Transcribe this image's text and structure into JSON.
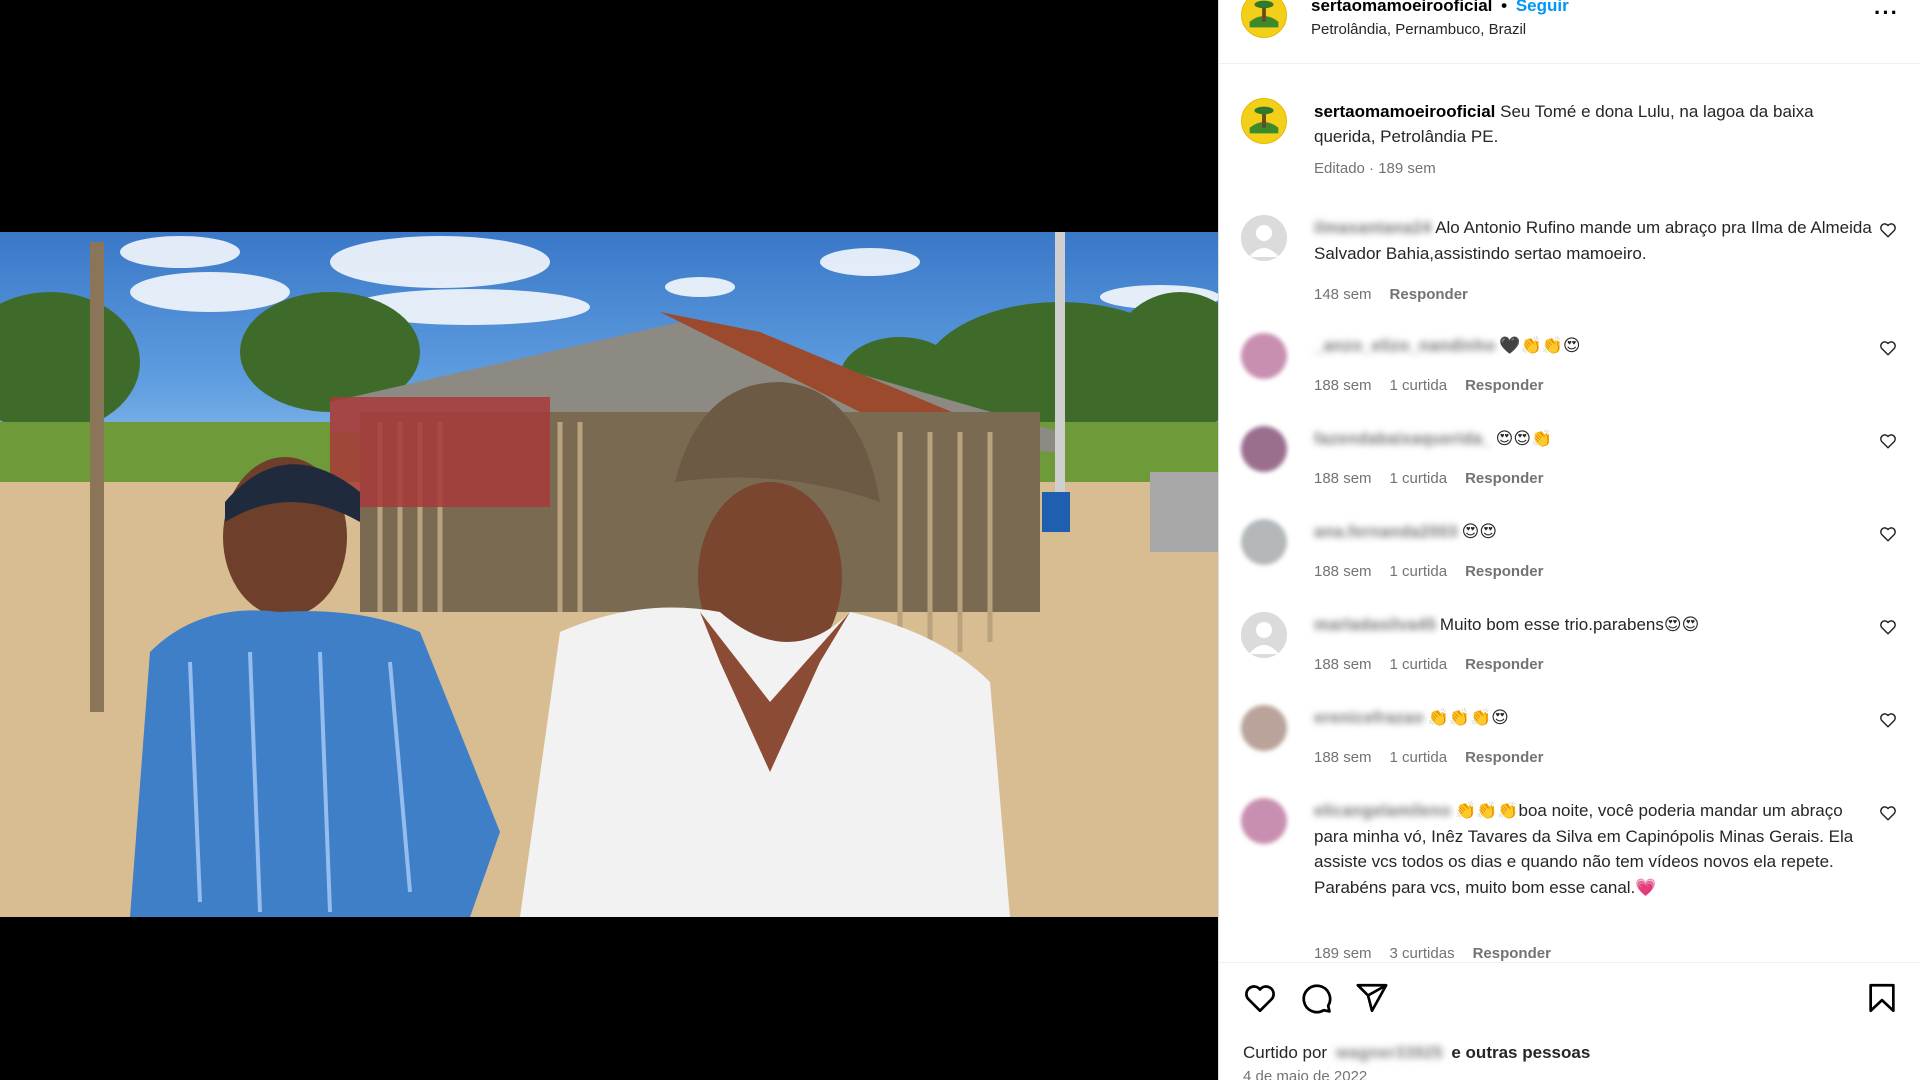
{
  "post": {
    "username": "sertaomamoeirooficial",
    "follow_label": "Seguir",
    "location": "Petrolândia, Pernambuco, Brazil",
    "more_icon": "more-horizontal-icon"
  },
  "caption": {
    "username": "sertaomamoeirooficial",
    "text": "Seu Tomé e dona Lulu, na lagoa da baixa querida, Petrolândia PE.",
    "meta": "Editado · 189 sem"
  },
  "comments": [
    {
      "user": "ilmasantana24",
      "text": "Alo Antonio Rufino mande um abraço pra Ilma de Almeida Salvador Bahia,assistindo sertao mamoeiro.",
      "time": "148 sem",
      "likes": "",
      "reply": "Responder",
      "avatar": "default"
    },
    {
      "user": "_anzo_elizo_nandinho",
      "text": "🖤👏👏😍",
      "time": "188 sem",
      "likes": "1 curtida",
      "reply": "Responder",
      "avatar": "photo"
    },
    {
      "user": "fazendabaixaquerida_",
      "text": "😍😍👏",
      "time": "188 sem",
      "likes": "1 curtida",
      "reply": "Responder",
      "avatar": "photo"
    },
    {
      "user": "ana.fernanda2003",
      "text": "😍😍",
      "time": "188 sem",
      "likes": "1 curtida",
      "reply": "Responder",
      "avatar": "photo"
    },
    {
      "user": "marladasilva45",
      "text": "Muito bom esse trio.parabens😍😍",
      "time": "188 sem",
      "likes": "1 curtida",
      "reply": "Responder",
      "avatar": "default"
    },
    {
      "user": "erenicefrazao",
      "text": "👏👏👏😍",
      "time": "188 sem",
      "likes": "1 curtida",
      "reply": "Responder",
      "avatar": "photo"
    },
    {
      "user": "elicangelamileno",
      "text": "👏👏👏boa noite, você poderia mandar um abraço para minha vó, Inêz Tavares da Silva em Capinópolis Minas Gerais. Ela assiste vcs todos os dias e quando não tem vídeos novos ela repete. Parabéns para vcs, muito bom esse canal.💗",
      "time": "189 sem",
      "likes": "3 curtidas",
      "reply": "Responder",
      "avatar": "photo"
    }
  ],
  "actions": {
    "liked_by_prefix": "Curtido por",
    "liked_by_user": "wagner33925",
    "liked_by_suffix": "e outras pessoas",
    "date": "4 de maio de 2022"
  },
  "icons": [
    "heart-icon",
    "comment-icon",
    "share-icon",
    "bookmark-icon"
  ]
}
